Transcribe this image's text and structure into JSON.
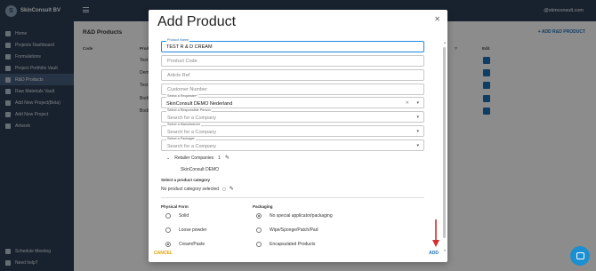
{
  "brand": {
    "logo": "S",
    "name": "SkinConsult BV"
  },
  "topbar": {
    "email": "@skinconsult.com"
  },
  "sidebar": {
    "items": [
      {
        "label": "Home",
        "active": false
      },
      {
        "label": "Projects Dashboard",
        "active": false
      },
      {
        "label": "Formulations",
        "active": false
      },
      {
        "label": "Project Portfolio Vault",
        "active": false
      },
      {
        "label": "R&D Products",
        "active": true
      },
      {
        "label": "Raw Materials Vault",
        "active": false
      },
      {
        "label": "Add New Project(Beta)",
        "active": false
      },
      {
        "label": "Add New Project",
        "active": false
      },
      {
        "label": "Artwork",
        "active": false
      }
    ],
    "bottom": [
      {
        "label": "Schedule Meeting"
      },
      {
        "label": "Need help?"
      }
    ]
  },
  "main": {
    "title": "R&D Products",
    "add_label": "+ ADD R&D PRODUCT",
    "columns": {
      "code": "Code",
      "product": "Prod",
      "edit": "Edit"
    },
    "rows": [
      "Test",
      "Dem",
      "Test",
      "Bodi",
      "Bodi"
    ]
  },
  "modal": {
    "title": "Add Product",
    "fields": {
      "product_name": {
        "label": "Product Name",
        "value": "TEST R & D CREAM"
      },
      "product_code": {
        "placeholder": "Product Code"
      },
      "article_ref": {
        "placeholder": "Article Ref"
      },
      "customer_number": {
        "placeholder": "Customer Number"
      },
      "requester": {
        "label": "Select a Requester*",
        "value": "SkinConsult DEMO Nederland"
      },
      "responsible": {
        "label": "Select a Responsible Person",
        "placeholder": "Search for a Company"
      },
      "manufacturer": {
        "label": "Select a Manufacturer",
        "placeholder": "Search for a Company"
      },
      "packager": {
        "label": "Select a Packager",
        "placeholder": "Search for a Company"
      }
    },
    "retailer": {
      "label": "Retailer Companies",
      "count": "1",
      "item": "SkinConsult DEMO"
    },
    "category": {
      "title": "Select a product category",
      "value": "No product category selected"
    },
    "physical_form": {
      "title": "Physical Form",
      "options": [
        {
          "label": "Solid",
          "selected": false
        },
        {
          "label": "Loose powder",
          "selected": false
        },
        {
          "label": "Cream/Paste",
          "selected": true
        }
      ]
    },
    "packaging": {
      "title": "Packaging",
      "options": [
        {
          "label": "No special applicator/packaging",
          "selected": true
        },
        {
          "label": "Wipe/Sponge/Patch/Pad",
          "selected": false
        },
        {
          "label": "Encapsulated Products",
          "selected": false
        }
      ]
    },
    "cancel_label": "CANCEL",
    "add_label": "ADD"
  },
  "colors": {
    "sidebar": "#2c3e55",
    "accent": "#1e6fb5",
    "cancel": "#e0a100",
    "arrow": "#d32f2f",
    "chat": "#1b8fd0"
  }
}
